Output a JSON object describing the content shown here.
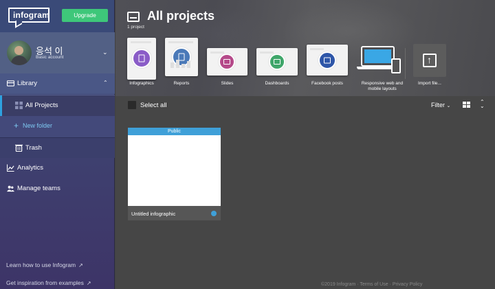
{
  "sidebar": {
    "logo_text": "infogram",
    "upgrade_label": "Upgrade",
    "profile": {
      "name": "응석 이",
      "account": "Basic account"
    },
    "library_label": "Library",
    "all_projects_label": "All Projects",
    "new_folder_label": "New folder",
    "trash_label": "Trash",
    "analytics_label": "Analytics",
    "manage_teams_label": "Manage teams",
    "footer_links": [
      "Learn how to use Infogram",
      "Get inspiration from examples"
    ]
  },
  "main": {
    "title": "All projects",
    "project_count": "1 project",
    "templates": [
      {
        "label": "Infographics",
        "color": "#8a5cc7",
        "icon": "infographic-icon"
      },
      {
        "label": "Reports",
        "color": "#4a79b8",
        "icon": "report-icon"
      },
      {
        "label": "Slides",
        "color": "#b54a8a",
        "icon": "slides-icon"
      },
      {
        "label": "Dashboards",
        "color": "#3fa66a",
        "icon": "dashboard-icon"
      },
      {
        "label": "Facebook posts",
        "color": "#2e56a8",
        "icon": "facebook-icon"
      },
      {
        "label": "Responsive web and mobile layouts",
        "color": "#3aa7e5",
        "icon": "responsive-icon"
      },
      {
        "label": "Import file...",
        "color": "#5c5c5c",
        "icon": "import-icon"
      }
    ],
    "toolbar": {
      "select_all": "Select all",
      "filter": "Filter"
    },
    "projects": [
      {
        "badge": "Public",
        "name": "Untitled infographic"
      }
    ],
    "footer": "©2019 Infogram · Terms of Use · Privacy Policy"
  }
}
